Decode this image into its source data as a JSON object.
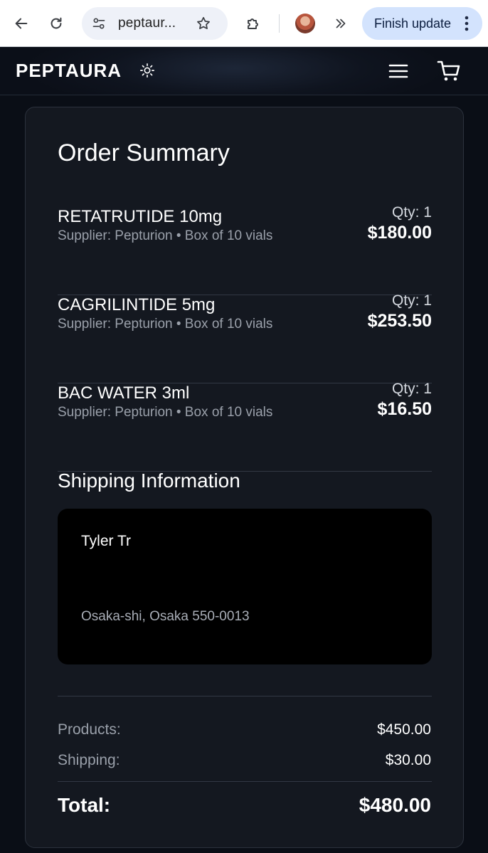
{
  "browser": {
    "url": "peptaur...",
    "finish_update_label": "Finish update"
  },
  "site": {
    "logo": "PEPTAURA"
  },
  "order": {
    "title": "Order Summary",
    "items": [
      {
        "name": "RETATRUTIDE 10mg",
        "supplier": "Supplier: Pepturion • Box of 10 vials",
        "qty": "Qty: 1",
        "price": "$180.00"
      },
      {
        "name": "CAGRILINTIDE 5mg",
        "supplier": "Supplier: Pepturion • Box of 10 vials",
        "qty": "Qty: 1",
        "price": "$253.50"
      },
      {
        "name": "BAC WATER 3ml",
        "supplier": "Supplier: Pepturion • Box of 10 vials",
        "qty": "Qty: 1",
        "price": "$16.50"
      }
    ]
  },
  "shipping": {
    "title": "Shipping Information",
    "name": "Tyler Tr",
    "city_line": "Osaka-shi, Osaka 550-0013"
  },
  "totals": {
    "products_label": "Products:",
    "products_value": "$450.00",
    "shipping_label": "Shipping:",
    "shipping_value": "$30.00",
    "total_label": "Total:",
    "total_value": "$480.00"
  },
  "icons": {
    "back": "back-arrow-icon",
    "reload": "reload-icon",
    "site_info": "tune-icon",
    "bookmark": "star-icon",
    "extensions": "puzzle-icon",
    "more_extensions": "double-chevron-icon",
    "kebab": "kebab-icon",
    "theme": "sun-icon",
    "menu": "hamburger-icon",
    "cart": "cart-icon"
  }
}
